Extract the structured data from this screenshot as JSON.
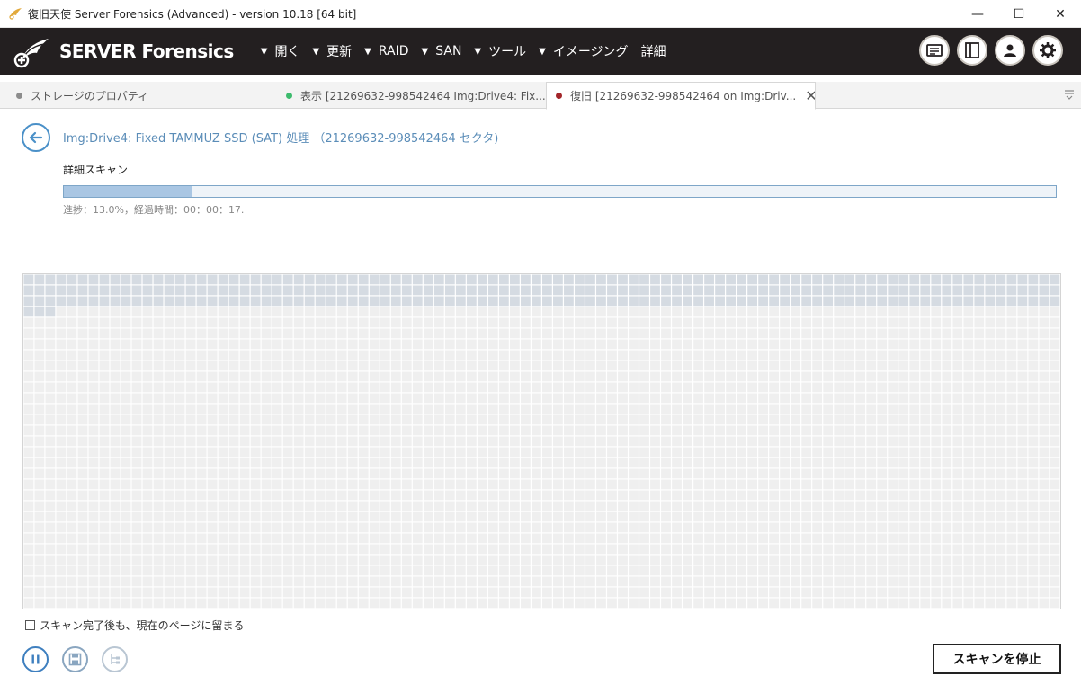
{
  "window": {
    "title": "復旧天使 Server Forensics (Advanced) - version 10.18 [64 bit]",
    "minimize": "—",
    "maximize": "☐",
    "close": "✕"
  },
  "menubar": {
    "logo_text": "SERVER Forensics",
    "items": [
      {
        "label": "開く",
        "has_caret": true
      },
      {
        "label": "更新",
        "has_caret": true
      },
      {
        "label": "RAID",
        "has_caret": true
      },
      {
        "label": "SAN",
        "has_caret": true
      },
      {
        "label": "ツール",
        "has_caret": true
      },
      {
        "label": "イメージング",
        "has_caret": true
      },
      {
        "label": "詳細",
        "has_caret": false
      }
    ],
    "caret": "▼",
    "toolbar_icons": [
      "log-icon",
      "panel-icon",
      "user-icon",
      "gear-icon"
    ]
  },
  "tabs": [
    {
      "label": "ストレージのプロパティ",
      "dot_color": "#8c8c8c",
      "active": false
    },
    {
      "label": "表示 [21269632-998542464 Img:Drive4: Fix...",
      "dot_color": "#3dbb6d",
      "active": false
    },
    {
      "label": "復旧 [21269632-998542464 on Img:Driv...",
      "dot_color": "#a3262a",
      "active": true
    }
  ],
  "tab_close": "✕",
  "content": {
    "title": "Img:Drive4: Fixed TAMMUZ SSD (SAT) 処理 （21269632-998542464 セクタ)",
    "section_label": "詳細スキャン",
    "progress_percent": 13.0,
    "progress_text": "進捗：13.0%，経過時間：00：00：17."
  },
  "scan_map": {
    "columns": 96,
    "rows": 31,
    "scanned_blocks": 291,
    "scanned_color": "#d5dbe2",
    "empty_color": "#efefef"
  },
  "stay_checkbox": {
    "label": "スキャン完了後も、現在のページに留まる",
    "checked": false
  },
  "controls": {
    "stop_label": "スキャンを停止"
  },
  "colors": {
    "menubar_bg": "#231f20",
    "accent": "#4a90c8",
    "progress_fill": "#a9c6e3"
  }
}
